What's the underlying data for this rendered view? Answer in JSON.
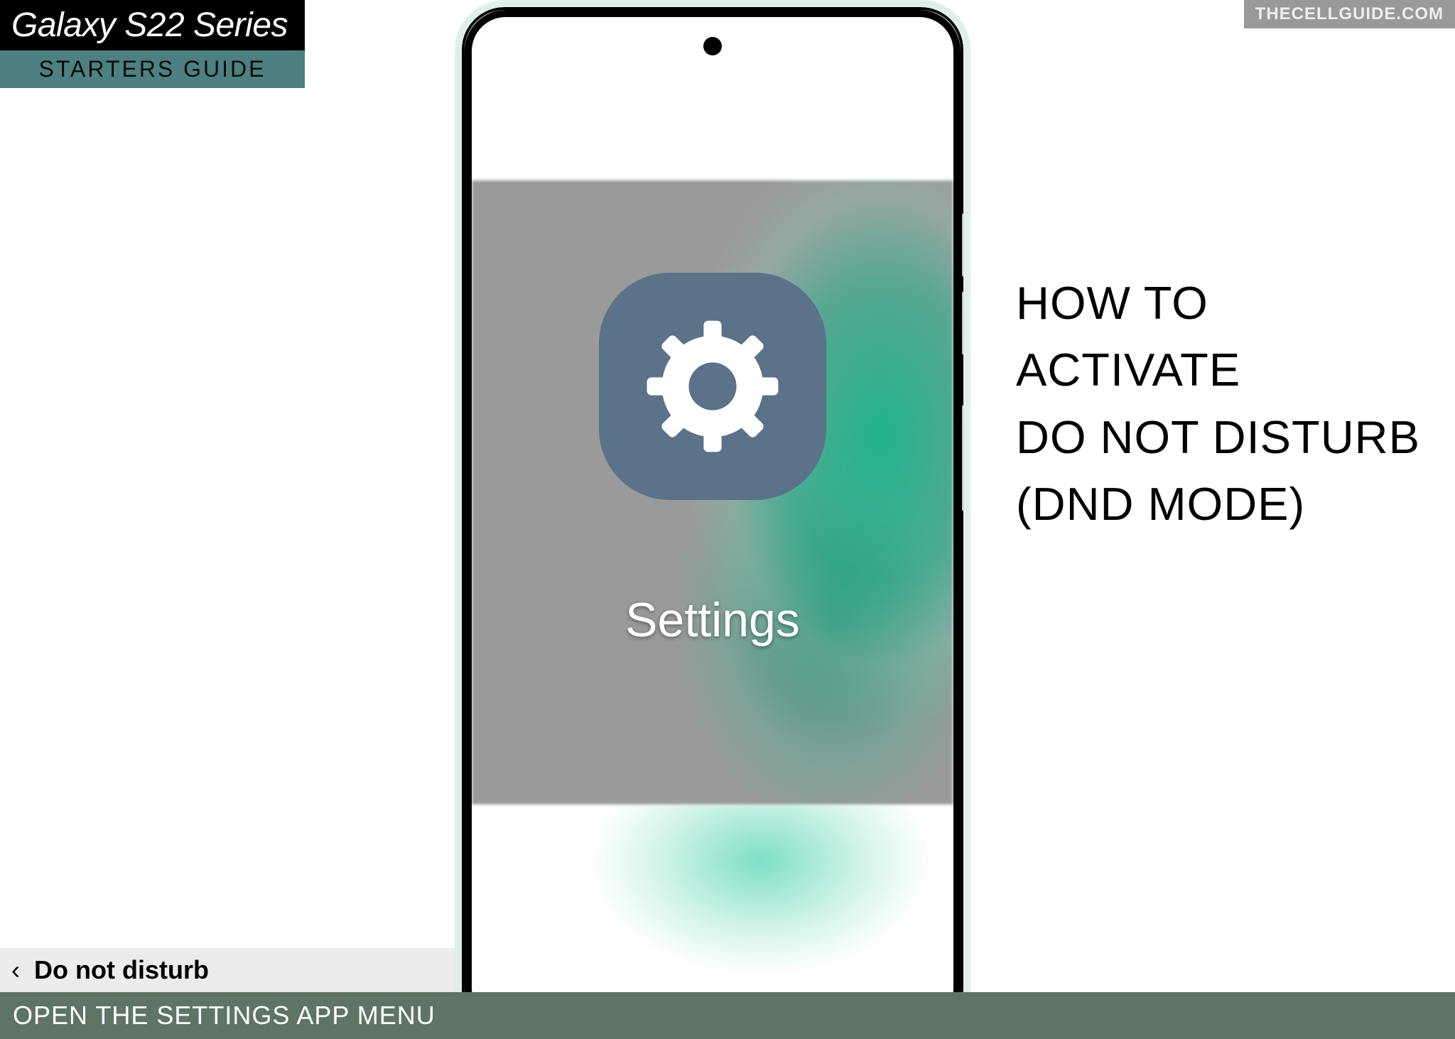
{
  "badge": {
    "title": "Galaxy S22 Series",
    "subtitle": "STARTERS GUIDE"
  },
  "watermark": "THECELLGUIDE.COM",
  "headline": {
    "l1": "HOW TO",
    "l2": "ACTIVATE",
    "l3": "DO NOT DISTURB",
    "l4": "(DND MODE)"
  },
  "phone": {
    "app_label": "Settings"
  },
  "breadcrumb": {
    "label": "Do not disturb"
  },
  "footer": {
    "caption": "OPEN THE SETTINGS APP MENU"
  }
}
